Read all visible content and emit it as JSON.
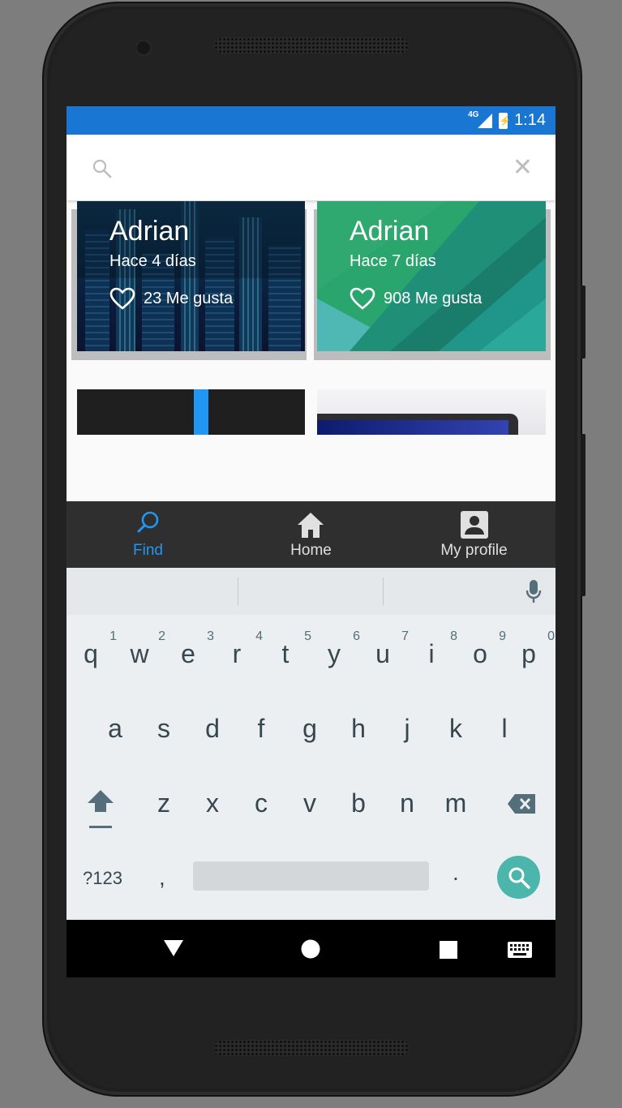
{
  "status_bar": {
    "network": "4G",
    "time": "1:14"
  },
  "search": {
    "placeholder": "",
    "value": ""
  },
  "posts": [
    {
      "author": "Adrian",
      "time_ago": "Hace 4 días",
      "likes": "23 Me gusta"
    },
    {
      "author": "Adrian",
      "time_ago": "Hace 7 días",
      "likes": "908 Me gusta"
    }
  ],
  "bottom_nav": [
    {
      "label": "Find",
      "icon": "search-icon",
      "active": true
    },
    {
      "label": "Home",
      "icon": "home-icon",
      "active": false
    },
    {
      "label": "My profile",
      "icon": "account-box-icon",
      "active": false
    }
  ],
  "keyboard": {
    "row1": [
      {
        "key": "q",
        "num": "1"
      },
      {
        "key": "w",
        "num": "2"
      },
      {
        "key": "e",
        "num": "3"
      },
      {
        "key": "r",
        "num": "4"
      },
      {
        "key": "t",
        "num": "5"
      },
      {
        "key": "y",
        "num": "6"
      },
      {
        "key": "u",
        "num": "7"
      },
      {
        "key": "i",
        "num": "8"
      },
      {
        "key": "o",
        "num": "9"
      },
      {
        "key": "p",
        "num": "0"
      }
    ],
    "row2": [
      "a",
      "s",
      "d",
      "f",
      "g",
      "h",
      "j",
      "k",
      "l"
    ],
    "row3": [
      "z",
      "x",
      "c",
      "v",
      "b",
      "n",
      "m"
    ],
    "symbols_label": "?123",
    "comma": ",",
    "period": "."
  },
  "colors": {
    "status_bar": "#1976d2",
    "accent": "#2196f3",
    "nav_bg": "#2f2f2f",
    "search_key": "#4db6ac"
  }
}
